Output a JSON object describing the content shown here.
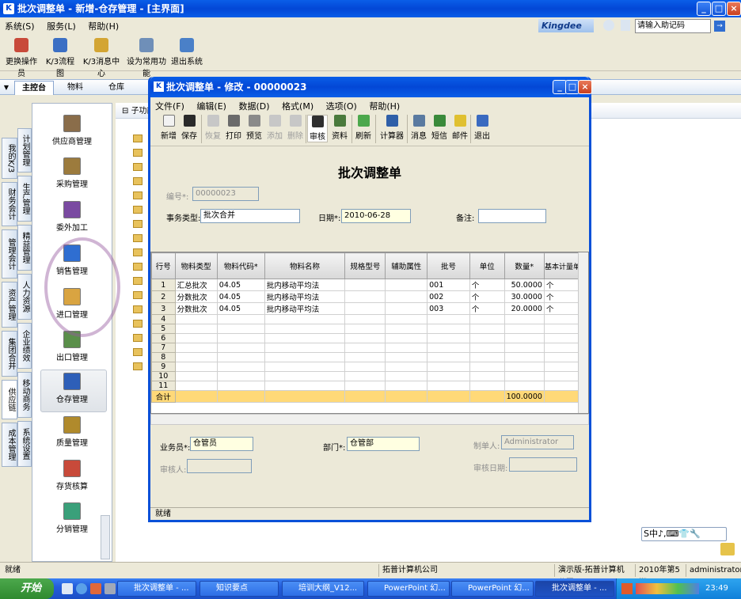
{
  "window": {
    "title": "批次调整单 - 新增-仓存管理 - [主界面]",
    "app_icon": "K",
    "min": "_",
    "max": "□",
    "close": "×"
  },
  "menu": [
    "系统(S)",
    "服务(L)",
    "帮助(H)"
  ],
  "brand": {
    "logo": "Kingdee",
    "help_placeholder": "请输入助记码",
    "go": "→"
  },
  "toolbar": [
    {
      "label": "更换操作员",
      "icon": "user-switch-icon",
      "color": "#c84a3a"
    },
    {
      "label": "K/3流程图",
      "icon": "flowchart-icon",
      "color": "#3b6fc4"
    },
    {
      "label": "K/3消息中心",
      "icon": "message-icon",
      "color": "#d3a533"
    },
    {
      "label": "设为常用功能",
      "icon": "favorite-icon",
      "color": "#6f8fb8"
    },
    {
      "label": "退出系统",
      "icon": "exit-icon",
      "color": "#4a80c8"
    }
  ],
  "module_tabs": [
    "主控台",
    "物料",
    "仓库"
  ],
  "vtabs_a": [
    "我的K/3",
    "财务会计",
    "管理会计",
    "资产管理",
    "集团合并",
    "供应链",
    "成本管理"
  ],
  "vtabs_b": [
    "计划管理",
    "生产管理",
    "精益管理",
    "人力资源",
    "企业绩效",
    "移动商务",
    "系统设置"
  ],
  "nav_items": [
    {
      "label": "供应商管理",
      "icon": "supplier-icon",
      "color": "#8a6d4a"
    },
    {
      "label": "采购管理",
      "icon": "purchase-icon",
      "color": "#9c7b3d"
    },
    {
      "label": "委外加工",
      "icon": "outsource-icon",
      "color": "#7a4aa1"
    },
    {
      "label": "销售管理",
      "icon": "sales-icon",
      "color": "#2f6ed1"
    },
    {
      "label": "进口管理",
      "icon": "import-icon",
      "color": "#d9a441"
    },
    {
      "label": "出口管理",
      "icon": "export-icon",
      "color": "#5a8f4a"
    },
    {
      "label": "仓存管理",
      "icon": "warehouse-icon",
      "color": "#2e5fb8"
    },
    {
      "label": "质量管理",
      "icon": "quality-icon",
      "color": "#b08a2c"
    },
    {
      "label": "存货核算",
      "icon": "inventory-accounting-icon",
      "color": "#c84a3a"
    },
    {
      "label": "分销管理",
      "icon": "distribution-icon",
      "color": "#3aa07a"
    }
  ],
  "bg_panel": {
    "header": "子功能"
  },
  "dialog": {
    "title": "批次调整单 - 修改 - 00000023",
    "menu": [
      "文件(F)",
      "编辑(E)",
      "数据(D)",
      "格式(M)",
      "选项(O)",
      "帮助(H)"
    ],
    "toolbar": [
      {
        "label": "新增",
        "icon": "new-icon",
        "color": "#f2f2f2",
        "enabled": true
      },
      {
        "label": "保存",
        "icon": "save-icon",
        "color": "#2a2a2a",
        "enabled": true
      },
      {
        "label": "恢复",
        "icon": "undo-icon",
        "color": "#c7c7c7",
        "enabled": false
      },
      {
        "label": "打印",
        "icon": "print-icon",
        "color": "#6a6a6a",
        "enabled": true
      },
      {
        "label": "预览",
        "icon": "preview-icon",
        "color": "#8a8a8a",
        "enabled": true
      },
      {
        "label": "添加",
        "icon": "add-row-icon",
        "color": "#c7c7c7",
        "enabled": false
      },
      {
        "label": "删除",
        "icon": "delete-row-icon",
        "color": "#c7c7c7",
        "enabled": false
      },
      {
        "label": "审核",
        "icon": "approve-icon",
        "color": "#2f2f2f",
        "enabled": true
      },
      {
        "label": "资料",
        "icon": "data-icon",
        "color": "#4a7a3c",
        "enabled": true
      },
      {
        "label": "刷新",
        "icon": "refresh-icon",
        "color": "#4ca84c",
        "enabled": true
      },
      {
        "label": "计算器",
        "icon": "calculator-icon",
        "color": "#2f5fa8",
        "enabled": true
      },
      {
        "label": "消息",
        "icon": "message-icon",
        "color": "#5a7aa0",
        "enabled": true
      },
      {
        "label": "短信",
        "icon": "sms-icon",
        "color": "#3a8a3a",
        "enabled": true
      },
      {
        "label": "邮件",
        "icon": "mail-icon",
        "color": "#e0c030",
        "enabled": true
      },
      {
        "label": "退出",
        "icon": "exit-icon",
        "color": "#3a6ac0",
        "enabled": true
      }
    ],
    "doc_title": "批次调整单",
    "fields": {
      "number": {
        "label": "编号*:",
        "value": "00000023"
      },
      "type": {
        "label": "事务类型:",
        "value": "批次合并"
      },
      "date": {
        "label": "日期*:",
        "value": "2010-06-28"
      },
      "remark": {
        "label": "备注:",
        "value": ""
      }
    },
    "grid": {
      "columns": [
        "行号",
        "物料类型",
        "物料代码*",
        "物料名称",
        "规格型号",
        "辅助属性",
        "批号",
        "单位",
        "数量*",
        "基本计量单位"
      ],
      "rows": [
        [
          "1",
          "汇总批次",
          "04.05",
          "批内移动平均法",
          "",
          "",
          "001",
          "个",
          "50.0000",
          "个"
        ],
        [
          "2",
          "分数批次",
          "04.05",
          "批内移动平均法",
          "",
          "",
          "002",
          "个",
          "30.0000",
          "个"
        ],
        [
          "3",
          "分数批次",
          "04.05",
          "批内移动平均法",
          "",
          "",
          "003",
          "个",
          "20.0000",
          "个"
        ],
        [
          "4",
          "",
          "",
          "",
          "",
          "",
          "",
          "",
          "",
          ""
        ],
        [
          "5",
          "",
          "",
          "",
          "",
          "",
          "",
          "",
          "",
          ""
        ],
        [
          "6",
          "",
          "",
          "",
          "",
          "",
          "",
          "",
          "",
          ""
        ],
        [
          "7",
          "",
          "",
          "",
          "",
          "",
          "",
          "",
          "",
          ""
        ],
        [
          "8",
          "",
          "",
          "",
          "",
          "",
          "",
          "",
          "",
          ""
        ],
        [
          "9",
          "",
          "",
          "",
          "",
          "",
          "",
          "",
          "",
          ""
        ],
        [
          "10",
          "",
          "",
          "",
          "",
          "",
          "",
          "",
          "",
          ""
        ],
        [
          "11",
          "",
          "",
          "",
          "",
          "",
          "",
          "",
          "",
          ""
        ]
      ],
      "total": {
        "label": "合计",
        "qty": "100.0000"
      }
    },
    "footer": {
      "salesman": {
        "label": "业务员*:",
        "value": "仓管员"
      },
      "dept": {
        "label": "部门*:",
        "value": "仓管部"
      },
      "maker": {
        "label": "制单人:",
        "value": "Administrator"
      },
      "auditor": {
        "label": "审核人:",
        "value": ""
      },
      "audit_date": {
        "label": "审核日期:",
        "value": ""
      }
    },
    "status": "就绪"
  },
  "ime": "S中♪,⌨👕🔧",
  "status_bar": {
    "left": "就绪",
    "company": "拓普计算机公司",
    "edition": "演示版-拓普计算机公司",
    "period": "2010年第5期",
    "user": "administrator"
  },
  "taskbar": {
    "start": "开始",
    "tasks": [
      "批次调整单 - ...",
      "知识要点",
      "培训大纲_V12...",
      "PowerPoint 幻...",
      "PowerPoint 幻...",
      "批次调整单 - ..."
    ],
    "clock": "23:49"
  }
}
